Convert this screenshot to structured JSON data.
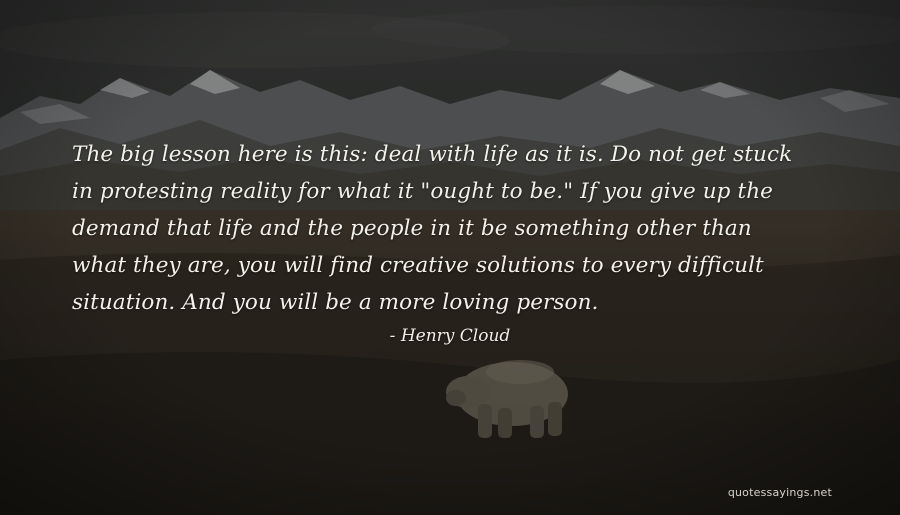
{
  "quote": {
    "lines": [
      "The big lesson here is this: deal with life as it is. Do not get stuck",
      "in protesting reality for what it \"ought to be.\" If you give up the",
      "demand that life and the people in it be something other than",
      "what they are, you will find creative solutions to every difficult",
      "situation. And you will be a more loving person."
    ],
    "author": "- Henry Cloud"
  },
  "watermark": "quotessayings.net",
  "scene": {
    "description_colors": {
      "sky_top": "#3b3e3f",
      "sky_mid": "#5a5b57",
      "mountains": "#6f7071",
      "snow": "#c9cbcc",
      "tundra": "#3a342b",
      "ground": "#28251f",
      "bear": "#8a8372"
    }
  }
}
